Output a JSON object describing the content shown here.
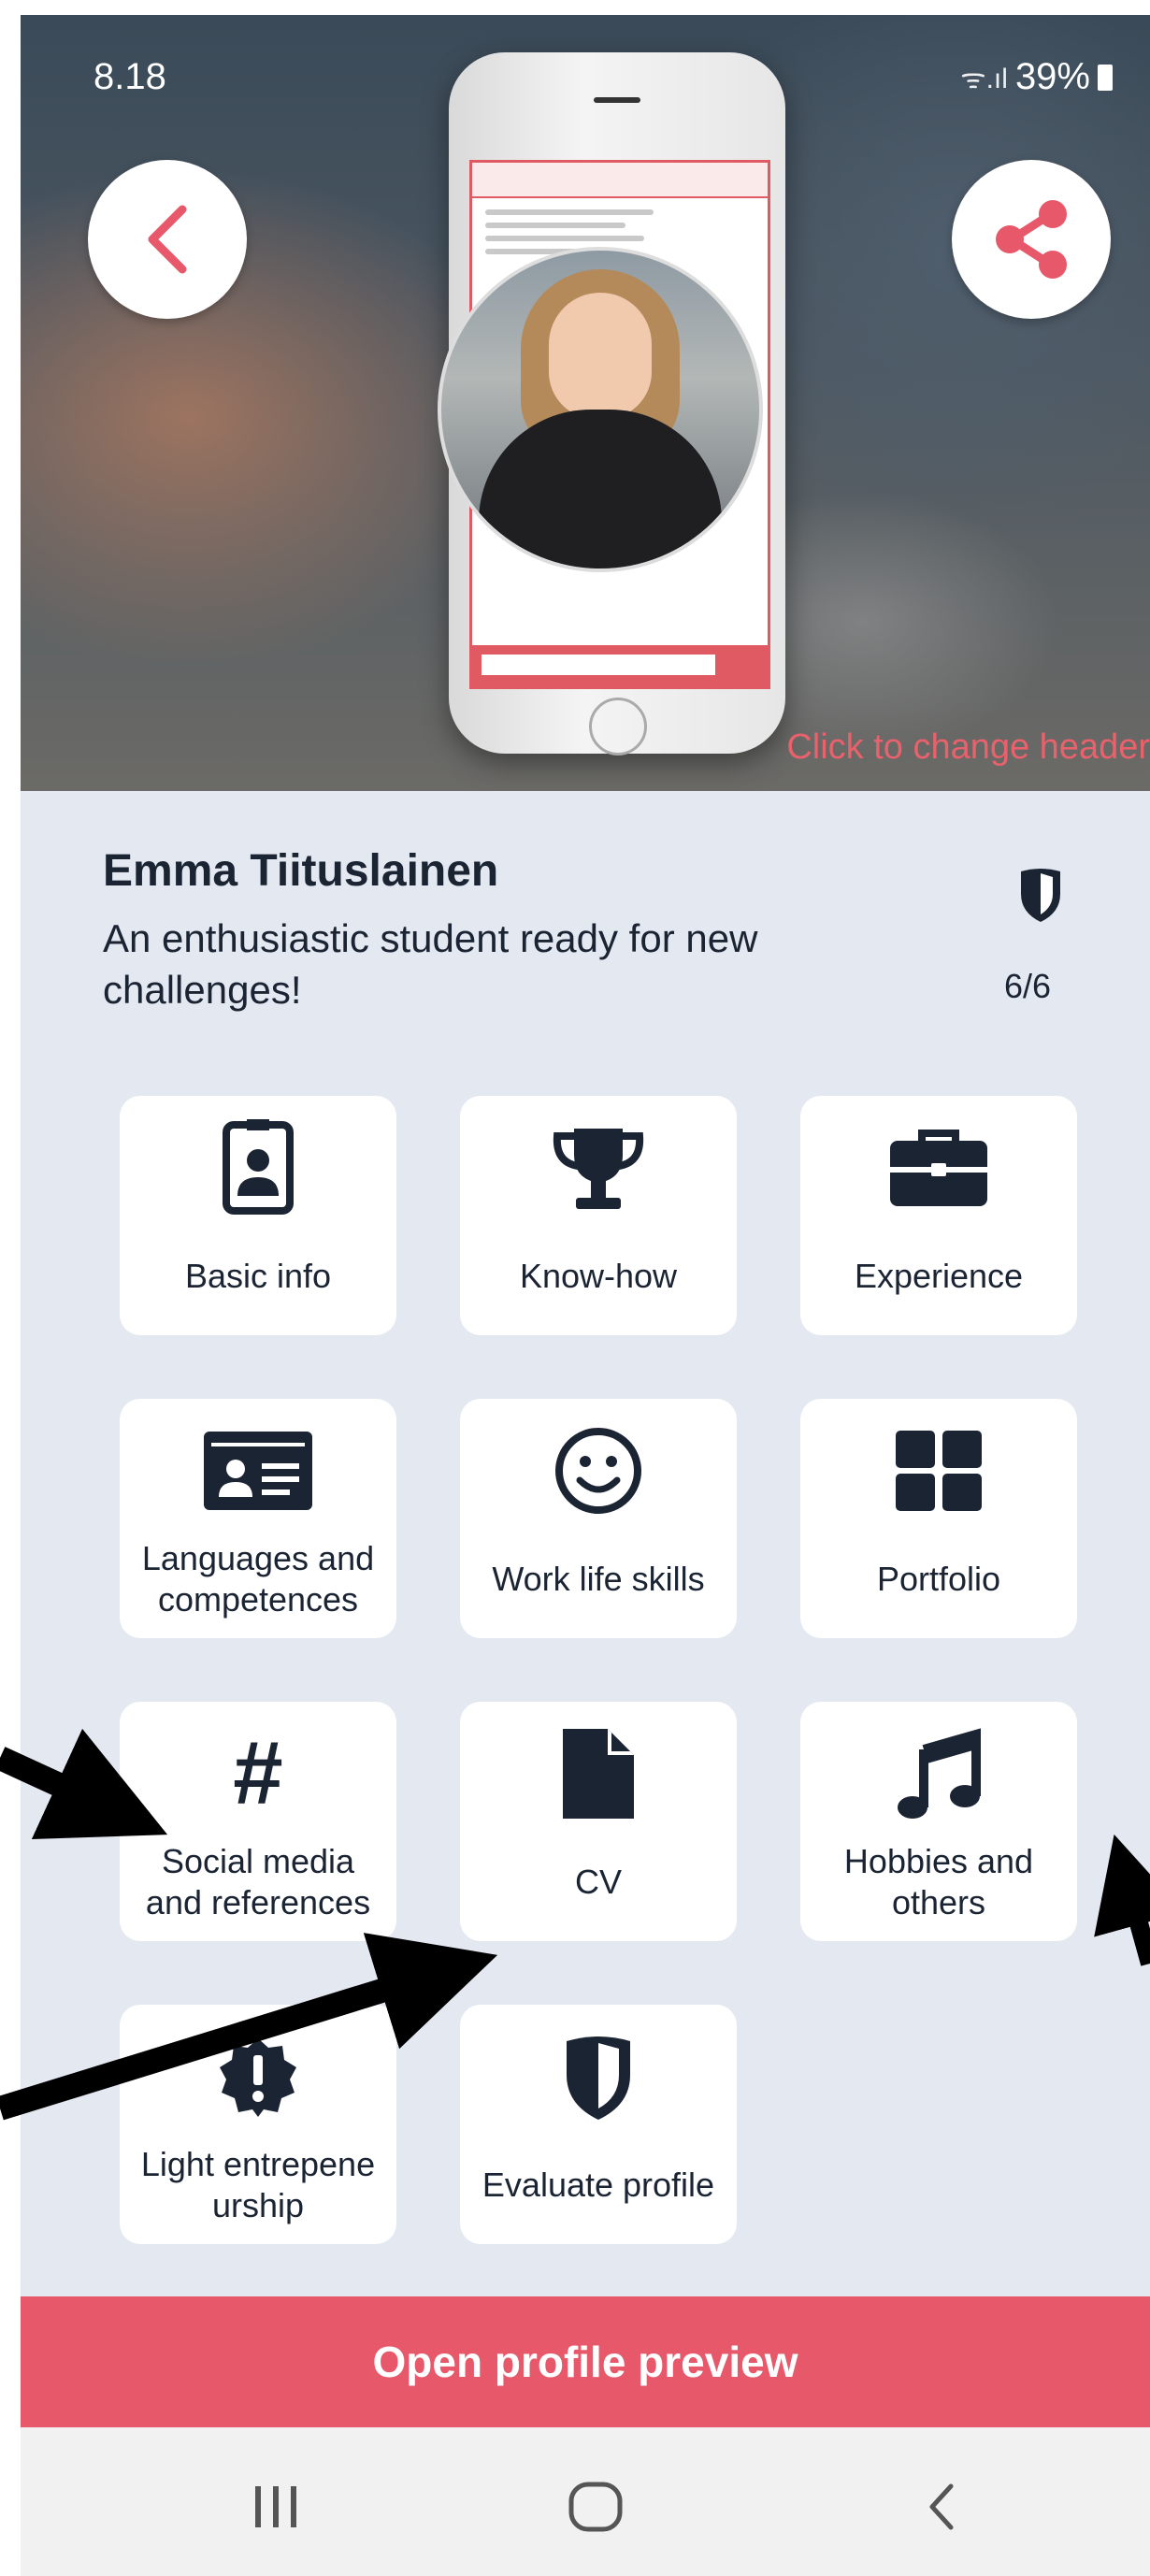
{
  "status_bar": {
    "time": "8.18",
    "battery": "39%",
    "signal": "ᯤ.ıl"
  },
  "header": {
    "back_icon": "chevron-left-icon",
    "share_icon": "share-icon",
    "change_header_label": "Click to change header"
  },
  "profile": {
    "name": "Emma Tiituslainen",
    "tagline": "An enthusiastic student ready for new challenges!",
    "score": "6/6",
    "score_icon": "shield-icon"
  },
  "tiles": [
    {
      "label": "Basic info",
      "icon": "id-badge-icon"
    },
    {
      "label": "Know-how",
      "icon": "trophy-icon"
    },
    {
      "label": "Experience",
      "icon": "briefcase-icon"
    },
    {
      "label": "Languages and competences",
      "icon": "id-card-icon"
    },
    {
      "label": "Work life skills",
      "icon": "smiley-icon"
    },
    {
      "label": "Portfolio",
      "icon": "grid-icon"
    },
    {
      "label": "Social media and references",
      "icon": "hashtag-icon"
    },
    {
      "label": "CV",
      "icon": "file-icon"
    },
    {
      "label": "Hobbies and others",
      "icon": "music-note-icon"
    },
    {
      "label": "Light entrepene urship",
      "icon": "badge-alert-icon"
    },
    {
      "label": "Evaluate profile",
      "icon": "shield-icon"
    }
  ],
  "preview_button": {
    "label": "Open profile preview"
  },
  "nav_bar": {
    "recents_icon": "recents-icon",
    "home_icon": "home-icon",
    "back_icon": "back-icon"
  },
  "colors": {
    "accent": "#e6586a",
    "background": "#e3e8f1",
    "text": "#1b2433",
    "tile": "#ffffff"
  }
}
